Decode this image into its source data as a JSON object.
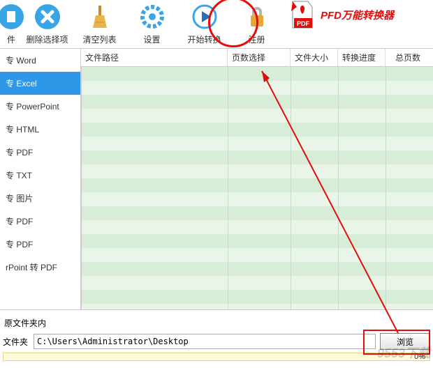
{
  "toolbar": {
    "items": [
      {
        "label": "件",
        "icon": "file"
      },
      {
        "label": "删除选择项",
        "icon": "delete"
      },
      {
        "label": "清空列表",
        "icon": "clear"
      },
      {
        "label": "设置",
        "icon": "settings"
      },
      {
        "label": "开始转换",
        "icon": "play"
      },
      {
        "label": "注册",
        "icon": "lock"
      }
    ],
    "brand": "PFD万能转换器"
  },
  "sidebar": {
    "items": [
      {
        "label": "专 Word"
      },
      {
        "label": "专 Excel",
        "active": true
      },
      {
        "label": "专 PowerPoint"
      },
      {
        "label": "专 HTML"
      },
      {
        "label": "专 PDF"
      },
      {
        "label": "专 TXT"
      },
      {
        "label": "专 图片"
      },
      {
        "label": "专 PDF"
      },
      {
        "label": "专 PDF"
      },
      {
        "label": "rPoint 转 PDF"
      }
    ]
  },
  "table": {
    "headers": [
      "文件路径",
      "页数选择",
      "文件大小",
      "转换进度",
      "总页数"
    ]
  },
  "bottom": {
    "label": "原文件夹内",
    "row_label": "文件夹",
    "path": "C:\\Users\\Administrator\\Desktop",
    "browse": "浏览",
    "progress": "0%"
  },
  "watermark": "9553下载"
}
